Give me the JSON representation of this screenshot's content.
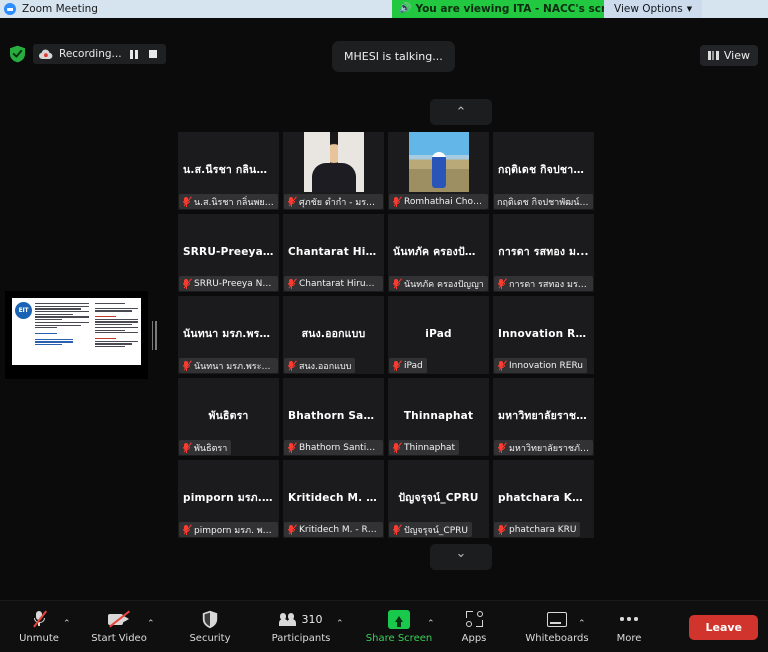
{
  "window": {
    "title": "Zoom Meeting",
    "logo_icon": "zoom-logo-icon"
  },
  "share_banner": {
    "speaker_icon": "speaker-icon",
    "text": "You are viewing ITA - NACC's screen",
    "bg_color": "#22c840"
  },
  "view_options": {
    "label": "View Options",
    "caret_icon": "chevron-down-icon"
  },
  "top_strip": {
    "encryption_icon": "green-shield-icon",
    "recording": {
      "cloud_icon": "cloud-record-icon",
      "label": "Recording...",
      "pause_icon": "pause-icon",
      "stop_icon": "stop-icon"
    },
    "talking_indicator": "MHESI is talking...",
    "view_button": {
      "grid_icon": "grid-view-icon",
      "label": "View"
    }
  },
  "shared_screen_thumbnail": {
    "name": "shared-screen-thumbnail",
    "logo_text": "EIT",
    "drag_handle_icon": "drag-handle-icon"
  },
  "scroll": {
    "up_icon": "chevron-up-icon",
    "down_icon": "chevron-down-icon"
  },
  "participants_grid": {
    "tiles": [
      {
        "display_name": "น.ส.นีรชา กลิ่นพย...",
        "badge_name": "น.ส.นิรชา กลิ่นพยอม",
        "muted": true,
        "video": "none"
      },
      {
        "display_name": "",
        "badge_name": "ศุภชัย ดำกำ - มรภ.สุรา...",
        "muted": true,
        "video": "photo-man-suit"
      },
      {
        "display_name": "",
        "badge_name": "Romhathai Chotikaso...",
        "muted": true,
        "video": "photo-woman-field"
      },
      {
        "display_name": "กฤติเดช กิจปชาพั...",
        "badge_name": "กฤติเดช กิจปชาพัฒน์ นิติกร",
        "muted": false,
        "video": "none"
      },
      {
        "display_name": "SRRU-Preeya N...",
        "badge_name": "SRRU-Preeya Ngarm...",
        "muted": true,
        "video": "none"
      },
      {
        "display_name": "Chantarat Hirun...",
        "badge_name": "Chantarat Hirunkitran...",
        "muted": true,
        "video": "none"
      },
      {
        "display_name": "นันทภัค ครองปัญ...",
        "badge_name": "นันทภัค ครองปัญญา",
        "muted": true,
        "video": "none"
      },
      {
        "display_name": "การดา รสทอง ม...",
        "badge_name": "การดา รสทอง มร.ราช..",
        "muted": true,
        "video": "none"
      },
      {
        "display_name": "นันทนา มรภ.พระ...",
        "badge_name": "นันทนา มรภ.พระนครศ..",
        "muted": true,
        "video": "none"
      },
      {
        "display_name": "สนง.ออกแบบ",
        "badge_name": "สนง.ออกแบบ",
        "muted": true,
        "video": "none"
      },
      {
        "display_name": "iPad",
        "badge_name": "iPad",
        "muted": true,
        "video": "none"
      },
      {
        "display_name": "Innovation RERu",
        "badge_name": "Innovation RERu",
        "muted": true,
        "video": "none"
      },
      {
        "display_name": "พันธิตรา",
        "badge_name": "พันธิตรา",
        "muted": true,
        "video": "none"
      },
      {
        "display_name": "Bhathorn Santi...",
        "badge_name": "Bhathorn Santiwong",
        "muted": true,
        "video": "none"
      },
      {
        "display_name": "Thinnaphat",
        "badge_name": "Thinnaphat",
        "muted": true,
        "video": "none"
      },
      {
        "display_name": "มหาวิทยาลัยราชภั...",
        "badge_name": "มหาวิทยาลัยราชภัฏศรีส...",
        "muted": true,
        "video": "none"
      },
      {
        "display_name": "pimporn มรภ. พ...",
        "badge_name": "pimporn มรภ. พระนคร",
        "muted": true,
        "video": "none"
      },
      {
        "display_name": "Kritidech M. - R...",
        "badge_name": "Kritidech M. - RBRU",
        "muted": true,
        "video": "none"
      },
      {
        "display_name": "ปัญจรุจน์_CPRU",
        "badge_name": "ปัญจรุจน์_CPRU",
        "muted": true,
        "video": "none"
      },
      {
        "display_name": "phatchara KRU",
        "badge_name": "phatchara KRU",
        "muted": true,
        "video": "none"
      }
    ]
  },
  "toolbar": {
    "unmute": {
      "label": "Unmute",
      "icon": "microphone-muted-icon",
      "caret_icon": "chevron-up-icon"
    },
    "start_video": {
      "label": "Start Video",
      "icon": "camera-off-icon",
      "caret_icon": "chevron-up-icon"
    },
    "security": {
      "label": "Security",
      "icon": "shield-icon"
    },
    "participants": {
      "label": "Participants",
      "icon": "people-icon",
      "count": "310",
      "caret_icon": "chevron-up-icon"
    },
    "share_screen": {
      "label": "Share Screen",
      "icon": "share-screen-icon",
      "caret_icon": "chevron-up-icon",
      "color": "#37d257"
    },
    "apps": {
      "label": "Apps",
      "icon": "apps-icon"
    },
    "whiteboards": {
      "label": "Whiteboards",
      "icon": "whiteboard-icon",
      "caret_icon": "chevron-up-icon"
    },
    "more": {
      "label": "More",
      "icon": "ellipsis-icon"
    },
    "leave": {
      "label": "Leave",
      "color": "#d0342c"
    }
  }
}
